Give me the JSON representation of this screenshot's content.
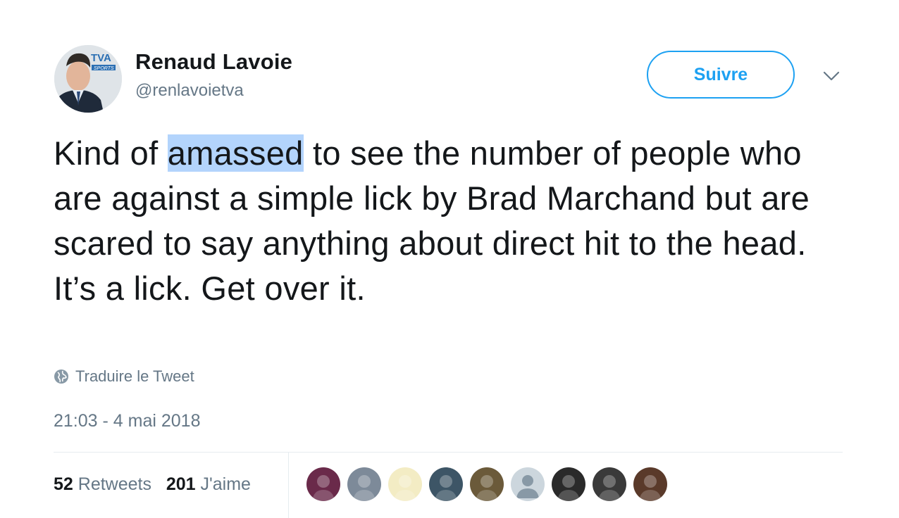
{
  "author": {
    "name": "Renaud Lavoie",
    "handle": "@renlavoietva",
    "avatar_badge": "TVA",
    "avatar_badge_sub": "SPORTS"
  },
  "follow_button": {
    "label": "Suivre"
  },
  "more_icon": "chevron-down-icon",
  "tweet": {
    "text_before": "Kind of ",
    "highlighted": "amassed",
    "text_after": " to see the number of people who are against a simple lick by Brad Marchand but are scared to say anything about direct hit to the head. It’s a lick. Get over it."
  },
  "translate": {
    "icon": "globe-icon",
    "label": "Traduire le Tweet"
  },
  "timestamp": "21:03 - 4 mai 2018",
  "stats": {
    "retweets_count": "52",
    "retweets_label": "Retweets",
    "likes_count": "201",
    "likes_label": "J'aime"
  },
  "likers": [
    {
      "color": "#6a2a4a"
    },
    {
      "color": "#7d8a99"
    },
    {
      "color": "#f3ecc4"
    },
    {
      "color": "#3d5566"
    },
    {
      "color": "#6b5a3a"
    },
    {
      "color": "#ccd6dd"
    },
    {
      "color": "#2a2a2a"
    },
    {
      "color": "#3a3a3a"
    },
    {
      "color": "#5a3a2a"
    }
  ],
  "colors": {
    "accent": "#1da1f2",
    "text": "#14171a",
    "secondary": "#657786",
    "highlight": "#b3d4fc",
    "divider": "#e6ecf0"
  }
}
